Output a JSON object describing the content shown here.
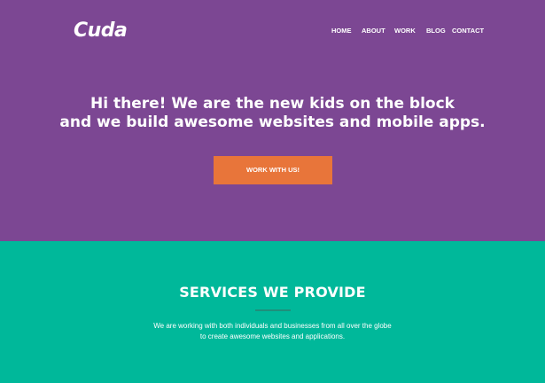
{
  "colors": {
    "hero_bg": "#7c4793",
    "cta_bg": "#e8753a",
    "services_bg": "#00b89a",
    "text": "#ffffff"
  },
  "brand": {
    "logo_text": "Cuda"
  },
  "nav": {
    "items": [
      {
        "label": "HOME"
      },
      {
        "label": "ABOUT"
      },
      {
        "label": "WORK"
      },
      {
        "label": "BLOG"
      },
      {
        "label": "CONTACT"
      }
    ]
  },
  "hero": {
    "headline_line1": "Hi there! We are the new kids on the block",
    "headline_line2": "and we build awesome websites and mobile apps.",
    "cta_label": "WORK WITH US!"
  },
  "services": {
    "title": "SERVICES WE PROVIDE",
    "description_line1": "We are working with both individuals and businesses from all over the globe",
    "description_line2": "to create awesome websites and applications."
  }
}
